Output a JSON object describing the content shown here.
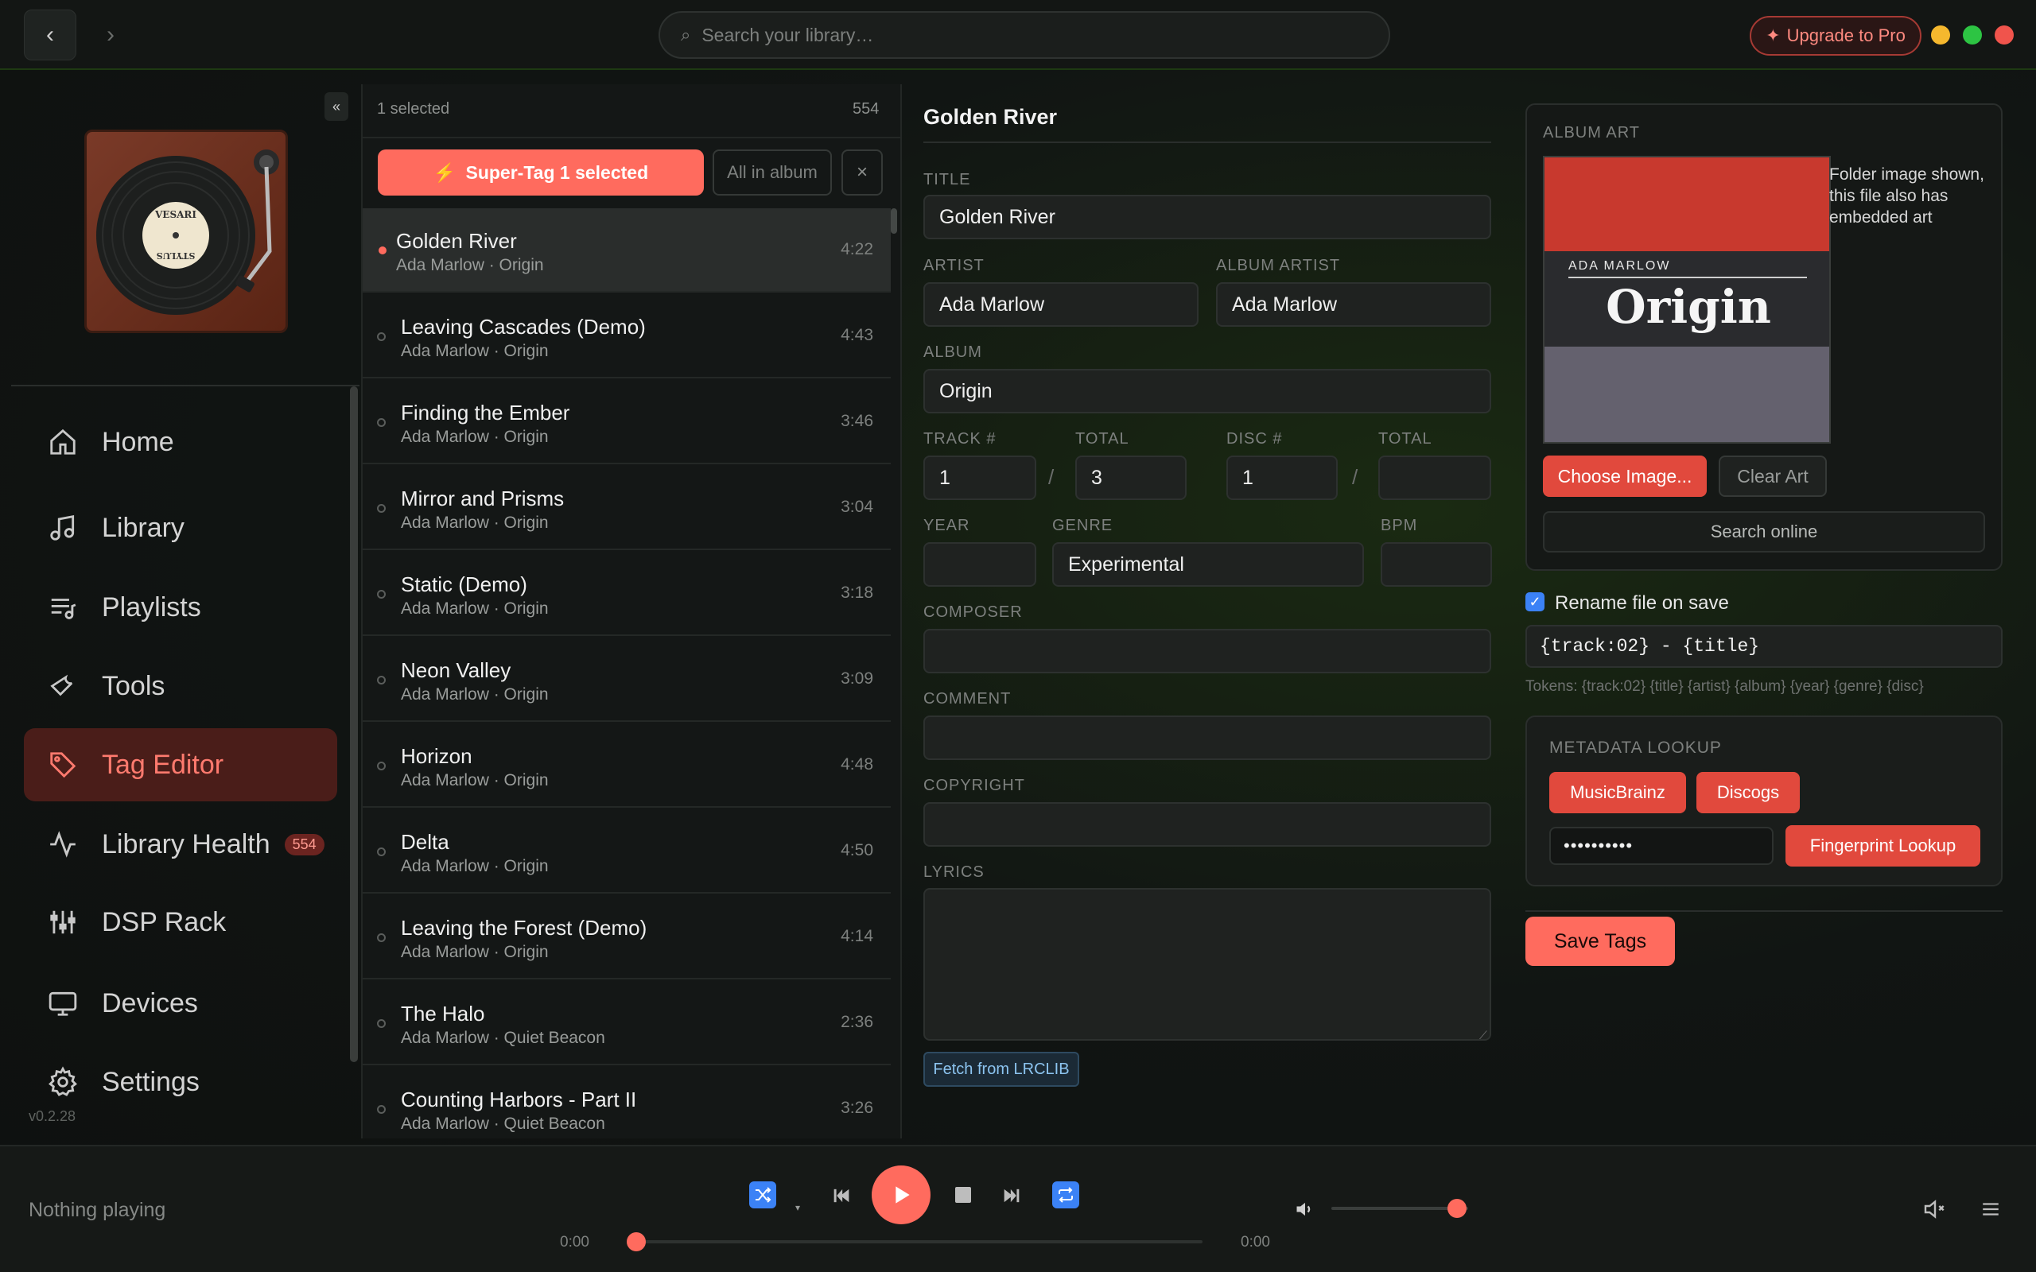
{
  "topbar": {
    "back": "‹",
    "forward": "›",
    "search_placeholder": "Search your library…",
    "upgrade": "Upgrade to Pro",
    "window_controls": {
      "minimize": "#f5b82e",
      "maximize": "#2dc443",
      "close": "#f0544c"
    }
  },
  "sidebar": {
    "collapse": "«",
    "logo_text_top": "VESARI",
    "logo_text_bottom": "STYLUS",
    "items": [
      {
        "label": "Home",
        "icon": "home-icon"
      },
      {
        "label": "Library",
        "icon": "music-note-icon"
      },
      {
        "label": "Playlists",
        "icon": "playlist-icon"
      },
      {
        "label": "Tools",
        "icon": "wrench-icon"
      },
      {
        "label": "Tag Editor",
        "icon": "tag-icon",
        "active": true
      },
      {
        "label": "Library Health",
        "icon": "pulse-icon",
        "badge": "554"
      },
      {
        "label": "DSP Rack",
        "icon": "sliders-icon"
      },
      {
        "label": "Devices",
        "icon": "monitor-icon"
      },
      {
        "label": "Settings",
        "icon": "gear-icon"
      }
    ],
    "version": "v0.2.28"
  },
  "tracklist": {
    "selected_text": "1 selected",
    "total": "554",
    "supertag": "Super-Tag 1 selected",
    "all_in_album": "All in album",
    "clear": "×",
    "tracks": [
      {
        "title": "Golden River",
        "sub": "Ada Marlow · Origin",
        "dur": "4:22",
        "selected": true
      },
      {
        "title": "Leaving Cascades (Demo)",
        "sub": "Ada Marlow · Origin",
        "dur": "4:43"
      },
      {
        "title": "Finding the Ember",
        "sub": "Ada Marlow · Origin",
        "dur": "3:46"
      },
      {
        "title": "Mirror and Prisms",
        "sub": "Ada Marlow · Origin",
        "dur": "3:04"
      },
      {
        "title": "Static (Demo)",
        "sub": "Ada Marlow · Origin",
        "dur": "3:18"
      },
      {
        "title": "Neon Valley",
        "sub": "Ada Marlow · Origin",
        "dur": "3:09"
      },
      {
        "title": "Horizon",
        "sub": "Ada Marlow · Origin",
        "dur": "4:48"
      },
      {
        "title": "Delta",
        "sub": "Ada Marlow · Origin",
        "dur": "4:50"
      },
      {
        "title": "Leaving the Forest (Demo)",
        "sub": "Ada Marlow · Origin",
        "dur": "4:14"
      },
      {
        "title": "The Halo",
        "sub": "Ada Marlow · Quiet Beacon",
        "dur": "2:36"
      },
      {
        "title": "Counting Harbors - Part II",
        "sub": "Ada Marlow · Quiet Beacon",
        "dur": "3:26"
      }
    ]
  },
  "editor": {
    "heading": "Golden River",
    "labels": {
      "title": "TITLE",
      "artist": "ARTIST",
      "album_artist": "ALBUM ARTIST",
      "album": "ALBUM",
      "track": "TRACK #",
      "track_total": "TOTAL",
      "disc": "DISC #",
      "disc_total": "TOTAL",
      "year": "YEAR",
      "genre": "GENRE",
      "bpm": "BPM",
      "composer": "COMPOSER",
      "comment": "COMMENT",
      "copyright": "COPYRIGHT",
      "lyrics": "LYRICS"
    },
    "values": {
      "title": "Golden River",
      "artist": "Ada Marlow",
      "album_artist": "Ada Marlow",
      "album": "Origin",
      "track": "1",
      "track_total": "3",
      "disc": "1",
      "disc_total": "",
      "year": "",
      "genre": "Experimental",
      "bpm": "",
      "composer": "",
      "comment": "",
      "copyright": "",
      "lyrics": ""
    },
    "fetch_lyrics": "Fetch from LRCLIB"
  },
  "art": {
    "label": "ALBUM ART",
    "art_artist": "ADA MARLOW",
    "art_title": "Origin",
    "note": "Folder image shown, this file also has embedded art",
    "choose": "Choose Image...",
    "clear": "Clear Art",
    "search_online": "Search online"
  },
  "rename": {
    "label": "Rename file on save",
    "checked": true,
    "pattern": "{track:02} - {title}",
    "tokens": "Tokens: {track:02} {title} {artist} {album} {year} {genre} {disc}"
  },
  "lookup": {
    "label": "METADATA LOOKUP",
    "musicbrainz": "MusicBrainz",
    "discogs": "Discogs",
    "api_key_mask": "••••••••••",
    "fingerprint": "Fingerprint Lookup"
  },
  "save_tags": "Save Tags",
  "player": {
    "now_playing": "Nothing playing",
    "time_start": "0:00",
    "time_end": "0:00",
    "progress": 0,
    "volume": 0.92,
    "accent": "#ff6b5e"
  }
}
